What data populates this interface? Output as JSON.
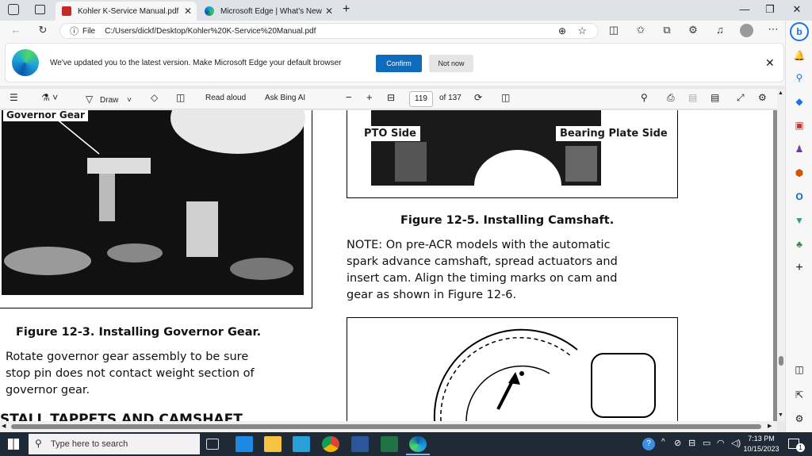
{
  "tabs": [
    {
      "title": "Kohler K-Service Manual.pdf",
      "active": true
    },
    {
      "title": "Microsoft Edge | What's New",
      "active": false
    }
  ],
  "address": {
    "file_label": "File",
    "url": "C:/Users/dickf/Desktop/Kohler%20K-Service%20Manual.pdf"
  },
  "banner": {
    "message": "We've updated you to the latest version. Make Microsoft Edge your default browser",
    "confirm": "Confirm",
    "not_now": "Not now"
  },
  "pdf_toolbar": {
    "draw": "Draw",
    "read_aloud": "Read aloud",
    "ask_bing": "Ask Bing AI",
    "minus": "−",
    "plus": "+",
    "page_current": "119",
    "page_total": "of 137"
  },
  "document": {
    "left_fig_label": "Governor Gear",
    "left_caption": "Figure 12-3. Installing Governor Gear.",
    "left_para": [
      "Rotate governor gear assembly to be sure",
      "stop pin does not contact weight section of",
      "governor gear."
    ],
    "left_heading_cut": "STALL TAPPETS AND CAMSHAFT",
    "pto_side": "PTO Side",
    "bearing_side": "Bearing Plate Side",
    "right_caption": "Figure 12-5. Installing Camshaft.",
    "note": [
      "NOTE: On pre-ACR models with the automatic",
      "spark advance camshaft, spread actuators and",
      "insert cam. Align the timing marks on cam and",
      "gear as shown in Figure 12-6."
    ]
  },
  "taskbar": {
    "search_placeholder": "Type here to search",
    "time": "7:13 PM",
    "date": "10/15/2023",
    "notification_count": "1"
  },
  "colors": {
    "accent": "#0f6cbd",
    "taskbar": "#202a36"
  }
}
